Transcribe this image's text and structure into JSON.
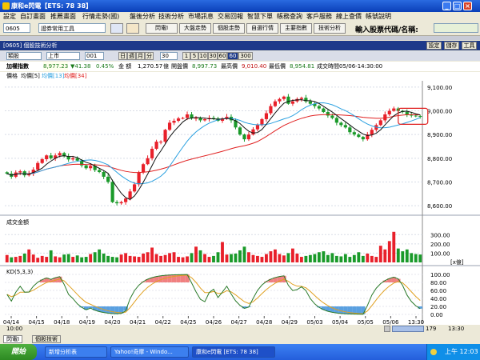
{
  "window": {
    "title": "康和e閃電【ETS: 78 38】"
  },
  "menu": [
    "設定",
    "自訂畫面",
    "推薦畫面",
    "行情走勢(國)",
    "盤後分析",
    "技術分析",
    "市場訊息",
    "交易回報",
    "智慧下單",
    "帳務查詢",
    "客戶服務",
    "線上查價",
    "帳號說明"
  ],
  "toolbar": {
    "code": "0605",
    "combo": "證券常用工具",
    "buttons": [
      "閃電I",
      "大盤走勢",
      "個股走勢",
      "自選行情",
      "主要指數",
      "技術分析"
    ],
    "stock_label": "輸入股票代碼/名稱:",
    "stock_value": ""
  },
  "panel": {
    "title": "[0605] 個股技術分析",
    "buttons": [
      "設定",
      "儲存",
      "工具"
    ]
  },
  "controls": {
    "type": "類股",
    "market": "上市",
    "num": "001",
    "periods": [
      "日",
      "週",
      "月",
      "分"
    ],
    "count": "30",
    "minutes": [
      "1",
      "5",
      "10",
      "30",
      "60"
    ],
    "active_min": "60",
    "custom": "300"
  },
  "info": {
    "name": "加權指數",
    "close": "8,977.23",
    "change": "▼41.38",
    "pct": "0.45%",
    "amount_label": "金 額",
    "amount": "1,270.57",
    "amount_unit": "億",
    "open_label": "開盤價",
    "open": "8,997.73",
    "high_label": "最高價",
    "high": "9,010.40",
    "low_label": "最低價",
    "low": "8,954.81",
    "time_label": "成交時間",
    "time": "05/06-14:30:00"
  },
  "legend": {
    "prefix": "價格",
    "ma1": "均價[5]",
    "ma2": "均價[13]",
    "ma3": "均價[34]"
  },
  "volume_panel": {
    "title": "成交金額",
    "unit": "[x億]"
  },
  "kd_panel": {
    "title": "KD(5,3,3)"
  },
  "time_start": "10:00",
  "scroll": {
    "value": "179",
    "end": "13:30"
  },
  "tabs": [
    "閃電I",
    "個股技術"
  ],
  "taskbar": {
    "start": "開始",
    "tasks": [
      "新增分析表",
      "Yahoo!奇摩 - Windo...",
      "康和e閃電 [ETS: 78 38]"
    ],
    "clock": "上午 12:03"
  },
  "colors": {
    "up": "#e8202a",
    "down": "#1a9a2a",
    "ma5": "#111111",
    "ma13": "#2aa0e0",
    "ma34": "#e02020",
    "k": "#2a7a2a",
    "d": "#e0a020",
    "panel_header": "#1d3a8a"
  },
  "chart_data": {
    "type": "candlestick",
    "x_labels": [
      "10:00",
      "04/14",
      "04/15",
      "04/18",
      "04/19",
      "04/20",
      "04/21",
      "04/22",
      "04/25",
      "04/26",
      "04/27",
      "04/28",
      "04/29",
      "05/03",
      "05/04",
      "05/05",
      "05/06",
      "13:30"
    ],
    "price_ticks": [
      8600,
      8700,
      8800,
      8900,
      9000,
      9100
    ],
    "price_labels": [
      "8,600.00",
      "8,700.00",
      "8,800.00",
      "8,900.00",
      "9,000.00",
      "9,100.00"
    ],
    "ylim": [
      8580,
      9120
    ],
    "closes": [
      8735,
      8722,
      8740,
      8745,
      8728,
      8735,
      8752,
      8780,
      8796,
      8812,
      8800,
      8812,
      8822,
      8808,
      8795,
      8800,
      8790,
      8770,
      8758,
      8768,
      8750,
      8742,
      8722,
      8700,
      8615,
      8610,
      8615,
      8630,
      8660,
      8690,
      8740,
      8775,
      8800,
      8840,
      8870,
      8870,
      8920,
      8950,
      8958,
      8968,
      8970,
      8985,
      8968,
      8970,
      8960,
      8965,
      8970,
      8968,
      8958,
      8968,
      8975,
      8960,
      8930,
      8900,
      8880,
      8900,
      8922,
      8940,
      8965,
      8990,
      9020,
      9040,
      9050,
      9060,
      9030,
      9040,
      9050,
      9055,
      9040,
      9030,
      9020,
      9010,
      8995,
      8980,
      8970,
      8950,
      8940,
      8930,
      8910,
      8900,
      8890,
      8880,
      8900,
      8920,
      8940,
      8960,
      8985,
      9000,
      9010,
      9000,
      8995,
      8985,
      8980,
      8978,
      8977
    ],
    "volume_ticks": [
      100,
      200,
      300
    ],
    "volume_labels": [
      "100.00",
      "200.00",
      "300.00"
    ],
    "volume_ylim": [
      0,
      380
    ],
    "volumes": [
      80,
      55,
      60,
      70,
      95,
      140,
      85,
      50,
      70,
      60,
      130,
      65,
      55,
      85,
      90,
      60,
      75,
      55,
      60,
      90,
      110,
      140,
      95,
      70,
      60,
      55,
      85,
      100,
      70,
      65,
      60,
      95,
      110,
      160,
      90,
      70,
      80,
      100,
      110,
      60,
      55,
      65,
      100,
      170,
      130,
      90,
      60,
      70,
      110,
      220,
      85,
      90,
      95,
      130,
      170,
      110,
      80,
      70,
      60,
      90,
      120,
      140,
      90,
      75,
      100,
      150,
      95,
      60,
      70,
      80,
      90,
      110,
      120,
      80,
      100,
      70,
      65,
      90,
      60,
      80,
      110,
      70,
      95,
      70,
      60,
      180,
      140,
      230,
      330,
      150,
      120,
      140,
      100,
      90,
      85
    ],
    "kd_ticks": [
      0,
      20,
      40,
      60,
      80,
      100
    ],
    "kd_labels": [
      "0.00",
      "20.00",
      "40.00",
      "60.00",
      "80.00",
      "100.00"
    ],
    "kd_ylim": [
      0,
      110
    ]
  }
}
